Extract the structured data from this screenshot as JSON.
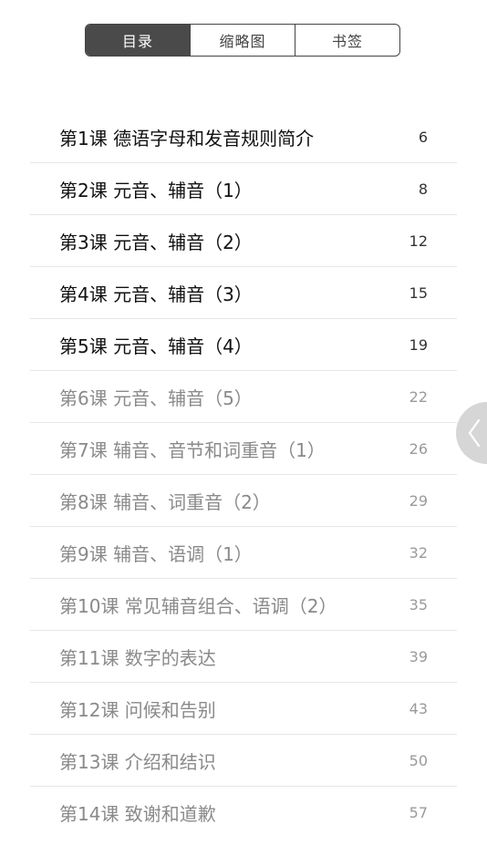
{
  "tabs": [
    {
      "label": "目录",
      "active": true
    },
    {
      "label": "缩略图",
      "active": false
    },
    {
      "label": "书签",
      "active": false
    }
  ],
  "toc": [
    {
      "title": "第1课 德语字母和发音规则简介",
      "page": "6",
      "read": true
    },
    {
      "title": "第2课 元音、辅音（1）",
      "page": "8",
      "read": true
    },
    {
      "title": "第3课 元音、辅音（2）",
      "page": "12",
      "read": true
    },
    {
      "title": "第4课 元音、辅音（3）",
      "page": "15",
      "read": true
    },
    {
      "title": "第5课 元音、辅音（4）",
      "page": "19",
      "read": true
    },
    {
      "title": "第6课 元音、辅音（5）",
      "page": "22",
      "read": false
    },
    {
      "title": "第7课 辅音、音节和词重音（1）",
      "page": "26",
      "read": false
    },
    {
      "title": "第8课 辅音、词重音（2）",
      "page": "29",
      "read": false
    },
    {
      "title": "第9课 辅音、语调（1）",
      "page": "32",
      "read": false
    },
    {
      "title": "第10课 常见辅音组合、语调（2）",
      "page": "35",
      "read": false
    },
    {
      "title": "第11课 数字的表达",
      "page": "39",
      "read": false
    },
    {
      "title": "第12课 问候和告别",
      "page": "43",
      "read": false
    },
    {
      "title": "第13课 介绍和结识",
      "page": "50",
      "read": false
    },
    {
      "title": "第14课 致谢和道歉",
      "page": "57",
      "read": false
    }
  ],
  "side_handle": {
    "icon": "chevron-left-icon"
  },
  "colors": {
    "active_tab_bg": "#4a4a4a",
    "read_text": "#111111",
    "unread_text": "#8a8a8a",
    "divider": "#e6e6e6",
    "handle_bg": "#d6d6d6"
  }
}
